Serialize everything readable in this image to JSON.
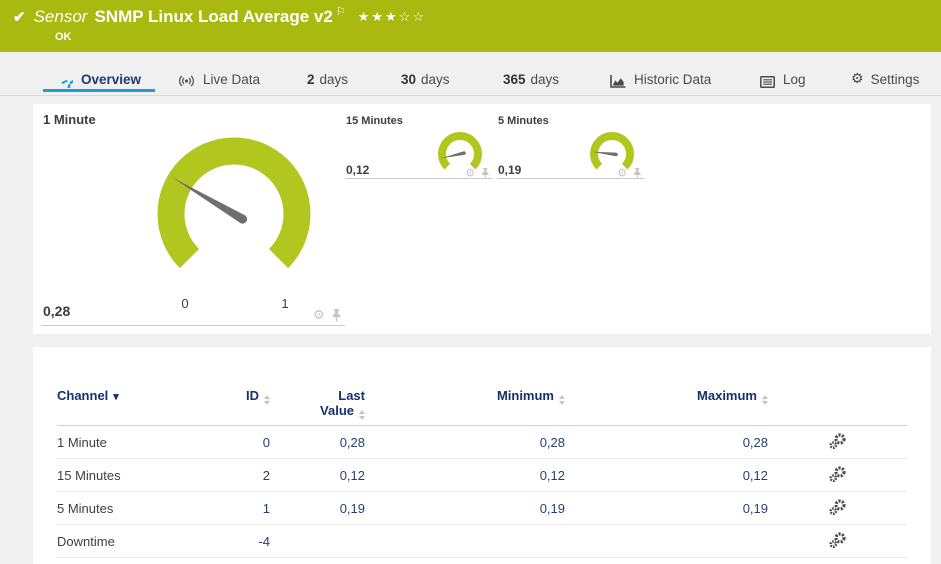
{
  "header": {
    "kind_label": "Sensor",
    "title": "SNMP Linux Load Average v2",
    "status": "OK",
    "stars_display": "★★★☆☆",
    "stars_filled": 3,
    "stars_total": 5
  },
  "tabs": {
    "overview": {
      "label": "Overview"
    },
    "live_data": {
      "label": "Live Data"
    },
    "days2": {
      "num": "2",
      "label": "days"
    },
    "days30": {
      "num": "30",
      "label": "days"
    },
    "days365": {
      "num": "365",
      "label": "days"
    },
    "historic": {
      "label": "Historic Data"
    },
    "log": {
      "label": "Log"
    },
    "settings": {
      "label": "Settings"
    }
  },
  "gauges": [
    {
      "name": "1 Minute",
      "value": 0.28,
      "display": "0,28",
      "min": 0,
      "max": 1,
      "scale_min_label": "0",
      "scale_max_label": "1"
    },
    {
      "name": "15 Minutes",
      "value": 0.12,
      "display": "0,12",
      "min": 0,
      "max": 1
    },
    {
      "name": "5 Minutes",
      "value": 0.19,
      "display": "0,19",
      "min": 0,
      "max": 1
    }
  ],
  "channel_table": {
    "columns": {
      "channel": "Channel",
      "id": "ID",
      "last_line1": "Last",
      "last_line2": "Value",
      "min": "Minimum",
      "max": "Maximum"
    },
    "rows": [
      {
        "channel": "1 Minute",
        "id": "0",
        "last": "0,28",
        "min": "0,28",
        "max": "0,28"
      },
      {
        "channel": "15 Minutes",
        "id": "2",
        "last": "0,12",
        "min": "0,12",
        "max": "0,12"
      },
      {
        "channel": "5 Minutes",
        "id": "1",
        "last": "0,19",
        "min": "0,19",
        "max": "0,19"
      },
      {
        "channel": "Downtime",
        "id": "-4",
        "last": "",
        "min": "",
        "max": ""
      }
    ]
  },
  "colors": {
    "header_green": "#a8b90f",
    "gauge_green": "#b1c61e",
    "accent_blue": "#1e9cd8",
    "navy": "#15316b"
  }
}
